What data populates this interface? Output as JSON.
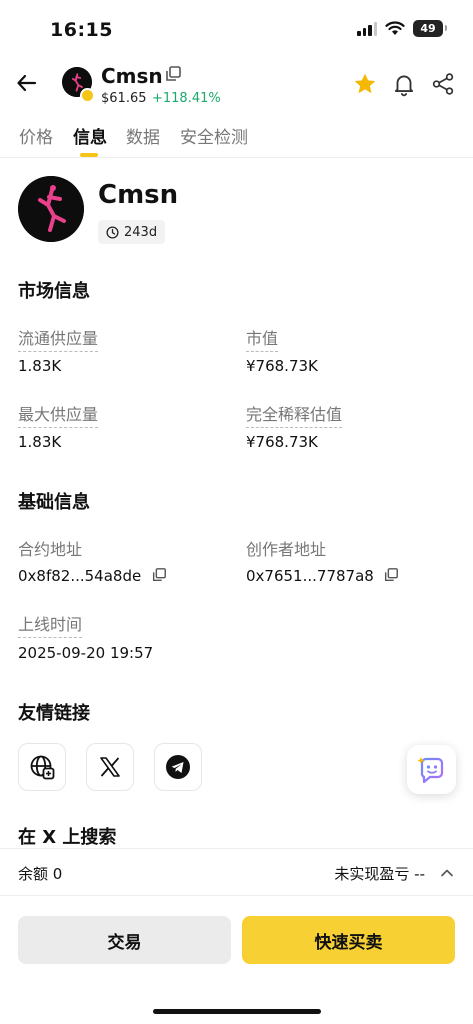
{
  "status": {
    "time": "16:15",
    "battery": "49"
  },
  "header": {
    "title": "Cmsn",
    "price": "$61.65",
    "change": "+118.41%",
    "icons": {
      "back": "back-arrow-icon",
      "copy": "copy-icon",
      "favorite": "star-icon",
      "alert": "bell-icon",
      "share": "share-icon"
    },
    "colors": {
      "favorite": "#f5b800",
      "change": "#1aaa6b"
    }
  },
  "tabs": [
    {
      "label": "价格",
      "active": false
    },
    {
      "label": "信息",
      "active": true
    },
    {
      "label": "数据",
      "active": false
    },
    {
      "label": "安全检测",
      "active": false
    }
  ],
  "token": {
    "name": "Cmsn",
    "age": "243d"
  },
  "market": {
    "title": "市场信息",
    "circulating_label": "流通供应量",
    "circulating_value": "1.83K",
    "market_cap_label": "市值",
    "market_cap_value": "¥768.73K",
    "max_supply_label": "最大供应量",
    "max_supply_value": "1.83K",
    "fdv_label": "完全稀释估值",
    "fdv_value": "¥768.73K"
  },
  "basic": {
    "title": "基础信息",
    "contract_label": "合约地址",
    "contract_value": "0x8f82...54a8de",
    "creator_label": "创作者地址",
    "creator_value": "0x7651...7787a8",
    "listed_label": "上线时间",
    "listed_value": "2025-09-20 19:57"
  },
  "links": {
    "title": "友情链接",
    "items": [
      {
        "icon": "website-globe-icon"
      },
      {
        "icon": "x-twitter-icon"
      },
      {
        "icon": "telegram-icon"
      }
    ]
  },
  "search_x": {
    "title": "在 X 上搜索"
  },
  "bottom": {
    "balance": "余额 0",
    "pnl": "未实现盈亏 --",
    "trade_label": "交易",
    "quick_label": "快速买卖",
    "colors": {
      "quick": "#f7d033",
      "trade": "#ebebeb"
    }
  }
}
